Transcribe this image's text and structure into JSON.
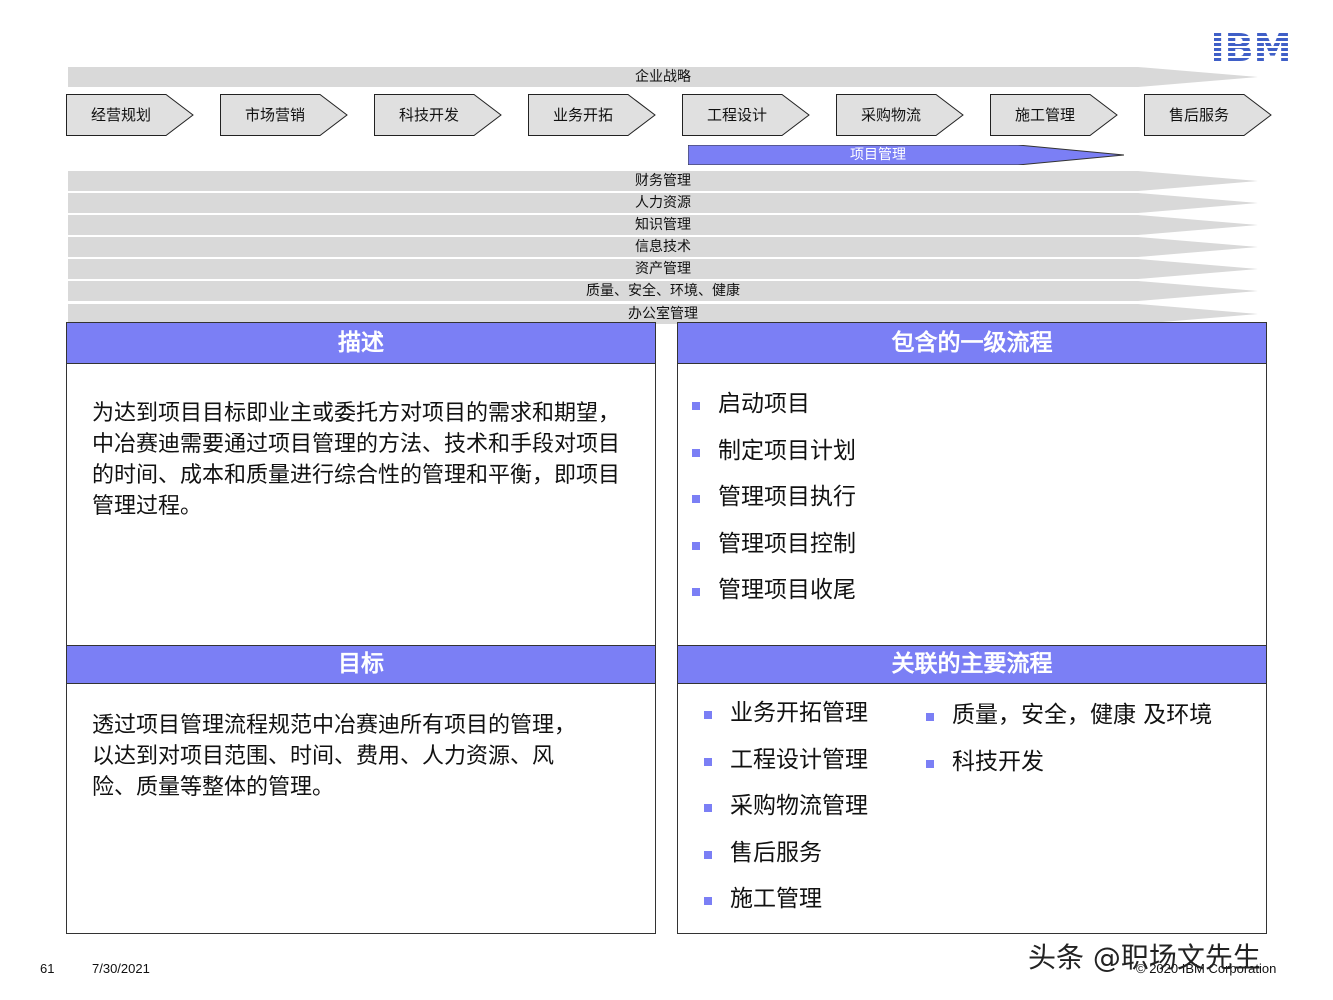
{
  "logo_text": "IBM",
  "strategy_band": "企业战略",
  "value_chain": [
    "经营规划",
    "市场营销",
    "科技开发",
    "业务开拓",
    "工程设计",
    "采购物流",
    "施工管理",
    "售后服务"
  ],
  "project_mgmt_band": "项目管理",
  "support_bands": [
    "财务管理",
    "人力资源",
    "知识管理",
    "信息技术",
    "资产管理",
    "质量、安全、环境、健康",
    "办公室管理"
  ],
  "description": {
    "title": "描述",
    "text": "为达到项目目标即业主或委托方对项目的需求和期望，中冶赛迪需要通过项目管理的方法、技术和手段对项目的时间、成本和质量进行综合性的管理和平衡，即项目管理过程。"
  },
  "level1": {
    "title": "包含的一级流程",
    "items": [
      "启动项目",
      "制定项目计划",
      "管理项目执行",
      "管理项目控制",
      "管理项目收尾"
    ]
  },
  "goal": {
    "title": "目标",
    "text": "透过项目管理流程规范中冶赛迪所有项目的管理，以达到对项目范围、时间、费用、人力资源、风险、质量等整体的管理。"
  },
  "related": {
    "title": "关联的主要流程",
    "col1": [
      "业务开拓管理",
      "工程设计管理",
      "采购物流管理",
      "售后服务",
      "施工管理"
    ],
    "col2": [
      "质量，安全，健康 及环境",
      "科技开发"
    ]
  },
  "footer": {
    "page_number": "61",
    "date": "7/30/2021",
    "copyright": "© 2020 IBM Corporation",
    "watermark": "头条 @职场文先生"
  },
  "colors": {
    "accent": "#7b7ff5",
    "band_gray": "#d9d9d9",
    "chevron_fill": "#e0e0e0",
    "ibm_blue": "#3f5fc7"
  }
}
